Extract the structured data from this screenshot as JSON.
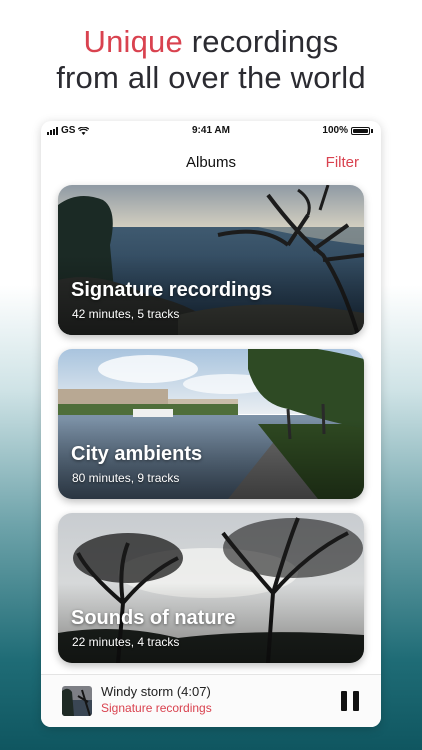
{
  "headline": {
    "accent": "Unique",
    "rest1": " recordings",
    "line2": "from all over the world"
  },
  "status": {
    "carrier": "GS",
    "time": "9:41 AM",
    "battery": "100%"
  },
  "nav": {
    "title": "Albums",
    "filter": "Filter"
  },
  "albums": [
    {
      "title": "Signature recordings",
      "meta": "42 minutes, 5 tracks"
    },
    {
      "title": "City ambients",
      "meta": "80 minutes, 9 tracks"
    },
    {
      "title": "Sounds of nature",
      "meta": "22 minutes, 4 tracks"
    }
  ],
  "player": {
    "track": "Windy storm (4:07)",
    "album": "Signature recordings"
  },
  "icons": [
    "signal-icon",
    "wifi-icon",
    "battery-icon",
    "pause-icon"
  ],
  "colors": {
    "accent": "#d9424f",
    "text": "#2b2b31"
  }
}
